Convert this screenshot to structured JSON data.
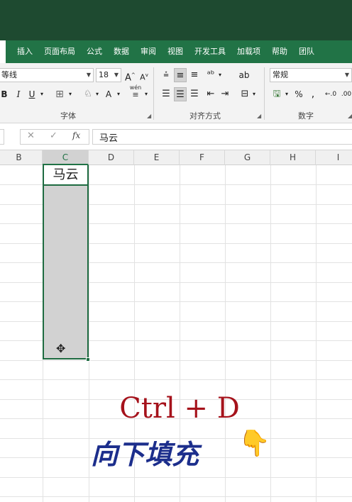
{
  "ribbon_tabs": [
    "插入",
    "页面布局",
    "公式",
    "数据",
    "审阅",
    "视图",
    "开发工具",
    "加载项",
    "帮助",
    "团队"
  ],
  "font": {
    "name": "等线",
    "size": "18",
    "bold": "B",
    "italic": "I",
    "underline": "U",
    "grow": "A",
    "shrink": "A",
    "color_letter": "A",
    "phonetic": "wén",
    "group_label": "字体"
  },
  "alignment": {
    "group_label": "对齐方式"
  },
  "number": {
    "format": "常规",
    "percent": "%",
    "comma": ",",
    "group_label": "数字"
  },
  "formula_bar": {
    "cancel": "✕",
    "enter": "✓",
    "fx": "fx",
    "value": "马云"
  },
  "columns": [
    "B",
    "C",
    "D",
    "E",
    "F",
    "G",
    "H",
    "I"
  ],
  "active_column": "C",
  "cell_c1": "马云",
  "caption": {
    "shortcut": "Ctrl + D",
    "text": "向下填充",
    "emoji": "👇"
  }
}
